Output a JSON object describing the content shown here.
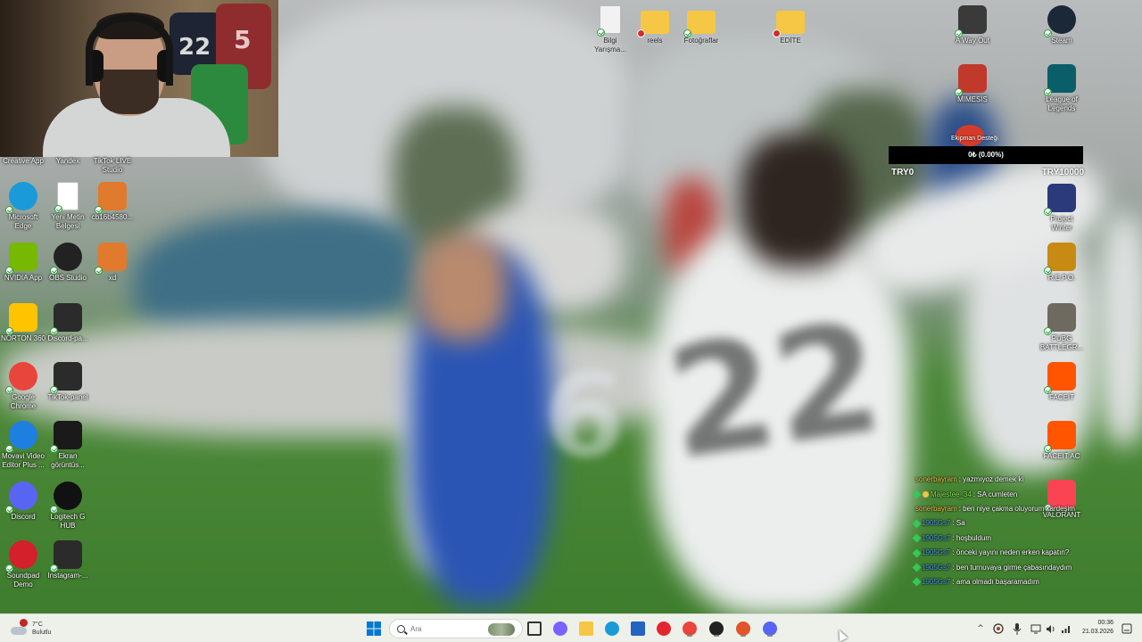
{
  "desktop": {
    "left_column": [
      {
        "label": "Creative App",
        "icon": "creative-app-icon",
        "color": "#2a6ad9"
      },
      {
        "label": "Yandex",
        "icon": "yandex-icon",
        "color": "#ffcc00"
      },
      {
        "label": "TikTok LIVE\nStudio",
        "icon": "tiktok-live-studio-icon",
        "color": "#111111"
      },
      {
        "label": "Microsoft\nEdge",
        "icon": "edge-icon",
        "color": "#1b9ad9"
      },
      {
        "label": "Yeni Metin\nBelgesi",
        "icon": "text-document-icon",
        "color": "#ffffff"
      },
      {
        "label": "cb16b4580...",
        "icon": "image-file-icon",
        "color": "#e07a2c"
      },
      {
        "label": "NVIDIA App",
        "icon": "nvidia-icon",
        "color": "#76b900"
      },
      {
        "label": "OBS Studio",
        "icon": "obs-icon",
        "color": "#222222"
      },
      {
        "label": "xd",
        "icon": "image-file-icon",
        "color": "#e07a2c"
      },
      {
        "label": "NORTON 360",
        "icon": "norton-icon",
        "color": "#ffc300"
      },
      {
        "label": "Discord-pa...",
        "icon": "discord-panel-icon",
        "color": "#2b2b2b"
      },
      {
        "label": "Google\nChrome",
        "icon": "chrome-icon",
        "color": "#e8453c"
      },
      {
        "label": "TikTok-panel",
        "icon": "tiktok-panel-icon",
        "color": "#2b2b2b"
      },
      {
        "label": "Movavi Video\nEditor Plus ...",
        "icon": "movavi-icon",
        "color": "#1f7fe0"
      },
      {
        "label": "Ekran\ngörüntüs...",
        "icon": "screenshot-icon",
        "color": "#1a1a1a"
      },
      {
        "label": "Discord",
        "icon": "discord-icon",
        "color": "#5865f2"
      },
      {
        "label": "Logitech G\nHUB",
        "icon": "logitech-g-icon",
        "color": "#111111"
      },
      {
        "label": "Soundpad\nDemo",
        "icon": "soundpad-icon",
        "color": "#d3202a"
      },
      {
        "label": "Instagram-...",
        "icon": "instagram-panel-icon",
        "color": "#2b2b2b"
      }
    ],
    "top_row": [
      {
        "label": "Bilgi\nYarışma...",
        "icon": "text-document-icon",
        "color": "#f2f2f2"
      },
      {
        "label": "reels",
        "icon": "folder-icon",
        "color": "#f6c744"
      },
      {
        "label": "Fotoğraflar",
        "icon": "folder-icon",
        "color": "#f6c744"
      },
      {
        "label": "EDİTE",
        "icon": "folder-icon",
        "color": "#f6c744"
      }
    ],
    "right_column": [
      {
        "label": "A Way Out",
        "icon": "a-way-out-icon",
        "color": "#3a3a3a"
      },
      {
        "label": "Steam",
        "icon": "steam-icon",
        "color": "#1b2838"
      },
      {
        "label": "MIMESIS",
        "icon": "mimesis-icon",
        "color": "#c0392b"
      },
      {
        "label": "League of\nLegends",
        "icon": "league-of-legends-icon",
        "color": "#0a5e6a"
      },
      {
        "label": "Project\nWinter",
        "icon": "project-winter-icon",
        "color": "#2b3a7a"
      },
      {
        "label": "R.E.P.O.",
        "icon": "repo-icon",
        "color": "#c88a12"
      },
      {
        "label": "PUBG\nBATTLEGR...",
        "icon": "pubg-icon",
        "color": "#6e6a60"
      },
      {
        "label": "FACEIT",
        "icon": "faceit-icon",
        "color": "#ff5500"
      },
      {
        "label": "FACEIT AC",
        "icon": "faceit-ac-icon",
        "color": "#ff5500"
      },
      {
        "label": "VALORANT",
        "icon": "valorant-icon",
        "color": "#fa4454"
      }
    ]
  },
  "donation_widget": {
    "title": "Ekipman Desteği",
    "progress_text": "0₺ (0.00%)",
    "progress_fraction": 0.0,
    "min_label": "TRY0",
    "max_label": "TRY10000",
    "bar_color": "#000000",
    "fill_color": "#6e3bd8"
  },
  "chat": {
    "messages": [
      {
        "user": "sonerbayram",
        "text": ": yazmıyoz demek ki",
        "user_color": "#f2c14e",
        "badge": "none"
      },
      {
        "user": "Majestee_34",
        "text": ": SA cumleten",
        "user_color": "#8ee05a",
        "badge": "green-gold"
      },
      {
        "user": "sonerbayram",
        "text": ": ben niye çakma oluyorum kardeşim",
        "user_color": "#f2c14e",
        "badge": "none"
      },
      {
        "user": "1905Gs7",
        "text": ": Sa",
        "user_color": "#4a90e2",
        "badge": "green"
      },
      {
        "user": "1905Gs7",
        "text": ": hoşbuldum",
        "user_color": "#4a90e2",
        "badge": "green"
      },
      {
        "user": "1905Gs7",
        "text": ": önceki yayını neden erken kapatın?",
        "user_color": "#4a90e2",
        "badge": "green"
      },
      {
        "user": "1905Gs7",
        "text": ": ben turnuvaya girme çabasındaydım",
        "user_color": "#4a90e2",
        "badge": "green"
      },
      {
        "user": "1905Gs7",
        "text": ": ama olmadı başaramadım",
        "user_color": "#4a90e2",
        "badge": "green"
      }
    ]
  },
  "taskbar": {
    "weather_temp": "7°C",
    "weather_desc": "Bulutlu",
    "search_placeholder": "Ara",
    "apps": [
      {
        "name": "start-button",
        "icon": "windows-logo-icon",
        "color": "#0078d4"
      },
      {
        "name": "task-view",
        "icon": "task-view-icon",
        "color": "#333333"
      },
      {
        "name": "copilot",
        "icon": "copilot-icon",
        "color": "#7b61ff"
      },
      {
        "name": "file-explorer",
        "icon": "folder-icon",
        "color": "#f6c744"
      },
      {
        "name": "edge",
        "icon": "edge-icon",
        "color": "#1b9ad9"
      },
      {
        "name": "microsoft-store",
        "icon": "store-icon",
        "color": "#2463c2"
      },
      {
        "name": "yandex",
        "icon": "yandex-icon",
        "color": "#e3262e"
      },
      {
        "name": "chrome",
        "icon": "chrome-icon",
        "color": "#e8453c"
      },
      {
        "name": "obs",
        "icon": "obs-icon",
        "color": "#222222"
      },
      {
        "name": "notification-app",
        "icon": "app-badge-icon",
        "color": "#e2542a"
      },
      {
        "name": "discord",
        "icon": "discord-icon",
        "color": "#5865f2"
      }
    ],
    "tray": [
      "chevron-up-icon",
      "antivirus-icon",
      "microphone-icon",
      "display-icon",
      "speaker-icon",
      "network-icon"
    ],
    "time": "00:36",
    "date": "21.03.2026"
  }
}
